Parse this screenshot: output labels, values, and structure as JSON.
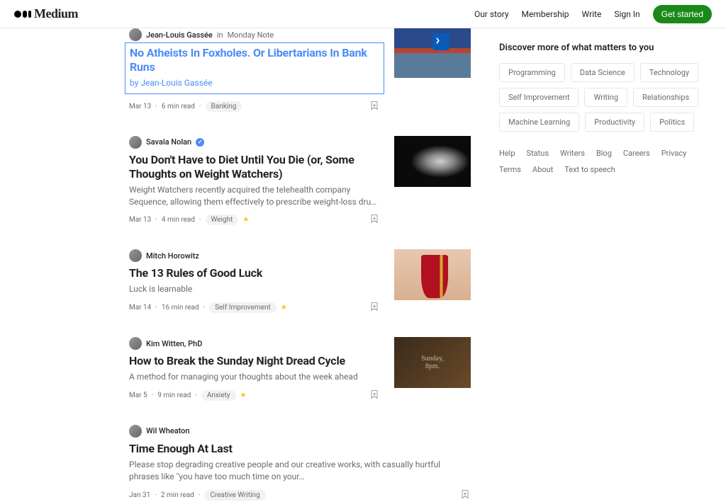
{
  "header": {
    "brand": "Medium",
    "nav": {
      "our_story": "Our story",
      "membership": "Membership",
      "write": "Write",
      "sign_in": "Sign In",
      "get_started": "Get started"
    }
  },
  "articles": [
    {
      "author": "Jean-Louis Gassée",
      "publication": "Monday Note",
      "title": "No Atheists In Foxholes. Or Libertarians In Bank Runs",
      "subtitle": "by Jean-Louis Gassée",
      "date": "Mar 13",
      "read": "6 min read",
      "tag": "Banking",
      "starred": false,
      "highlighted": true
    },
    {
      "author": "Savala Nolan",
      "verified": true,
      "title": "You Don't Have to Diet Until You Die (or, Some Thoughts on Weight Watchers)",
      "subtitle": "Weight Watchers recently acquired the telehealth company Sequence, allowing them effectively to prescribe weight-loss dru…",
      "date": "Mar 13",
      "read": "4 min read",
      "tag": "Weight",
      "starred": true
    },
    {
      "author": "Mitch Horowitz",
      "title": "The 13 Rules of Good Luck",
      "subtitle": "Luck is learnable",
      "date": "Mar 14",
      "read": "16 min read",
      "tag": "Self Improvement",
      "starred": true
    },
    {
      "author": "Kim Witten, PhD",
      "title": "How to Break the Sunday Night Dread Cycle",
      "subtitle": "A method for managing your thoughts about the week ahead",
      "date": "Mar 5",
      "read": "9 min read",
      "tag": "Anxiety",
      "starred": true,
      "img_text1": "Sunday,",
      "img_text2": "8pm."
    },
    {
      "author": "Wil Wheaton",
      "title": "Time Enough At Last",
      "subtitle": "Please stop degrading creative people and our creative works, with casually hurtful phrases like \"you have too much time on your…",
      "date": "Jan 31",
      "read": "2 min read",
      "tag": "Creative Writing",
      "starred": false
    }
  ],
  "sidebar": {
    "title": "Discover more of what matters to you",
    "topics": [
      "Programming",
      "Data Science",
      "Technology",
      "Self Improvement",
      "Writing",
      "Relationships",
      "Machine Learning",
      "Productivity",
      "Politics"
    ],
    "links": [
      "Help",
      "Status",
      "Writers",
      "Blog",
      "Careers",
      "Privacy",
      "Terms",
      "About",
      "Text to speech"
    ]
  }
}
